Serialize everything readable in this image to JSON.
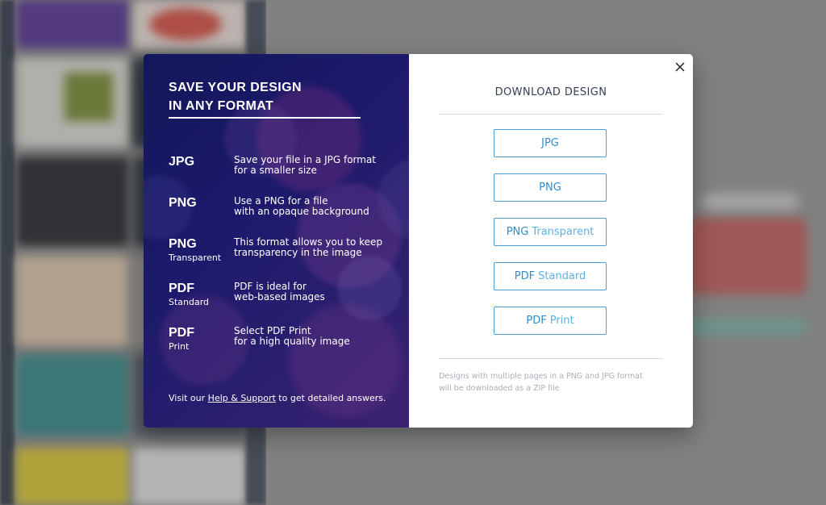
{
  "left_panel": {
    "heading_line1": "SAVE YOUR DESIGN",
    "heading_line2": "IN ANY FORMAT",
    "formats": [
      {
        "name": "JPG",
        "sub": "",
        "desc1": "Save your file in a JPG format",
        "desc2": "for a smaller size"
      },
      {
        "name": "PNG",
        "sub": "",
        "desc1": "Use a PNG for a file",
        "desc2": "with an opaque background"
      },
      {
        "name": "PNG",
        "sub": "Transparent",
        "desc1": "This format allows you to keep",
        "desc2": "transparency in the image"
      },
      {
        "name": "PDF",
        "sub": "Standard",
        "desc1": "PDF is ideal for",
        "desc2": "web-based images"
      },
      {
        "name": "PDF",
        "sub": "Print",
        "desc1": "Select PDF Print",
        "desc2": "for a high quality image"
      }
    ],
    "footer_prefix": "Visit our ",
    "footer_link": "Help & Support",
    "footer_suffix": " to get detailed answers."
  },
  "right_panel": {
    "title": "DOWNLOAD DESIGN",
    "buttons": [
      {
        "strong": "JPG",
        "light": ""
      },
      {
        "strong": "PNG",
        "light": ""
      },
      {
        "strong": "PNG",
        "light": "Transparent"
      },
      {
        "strong": "PDF",
        "light": "Standard"
      },
      {
        "strong": "PDF",
        "light": "Print"
      }
    ],
    "note_line1": "Designs with multiple pages in a PNG and JPG format",
    "note_line2": "will be downloaded as a ZIP file"
  },
  "icons": {
    "close": "close-icon"
  },
  "colors": {
    "left_panel_bg": "#1d1a6b",
    "button_border": "#4a9fd8",
    "button_text": "#2d8ccf",
    "title_text": "#333f52",
    "note_text": "#a9b0bb"
  }
}
